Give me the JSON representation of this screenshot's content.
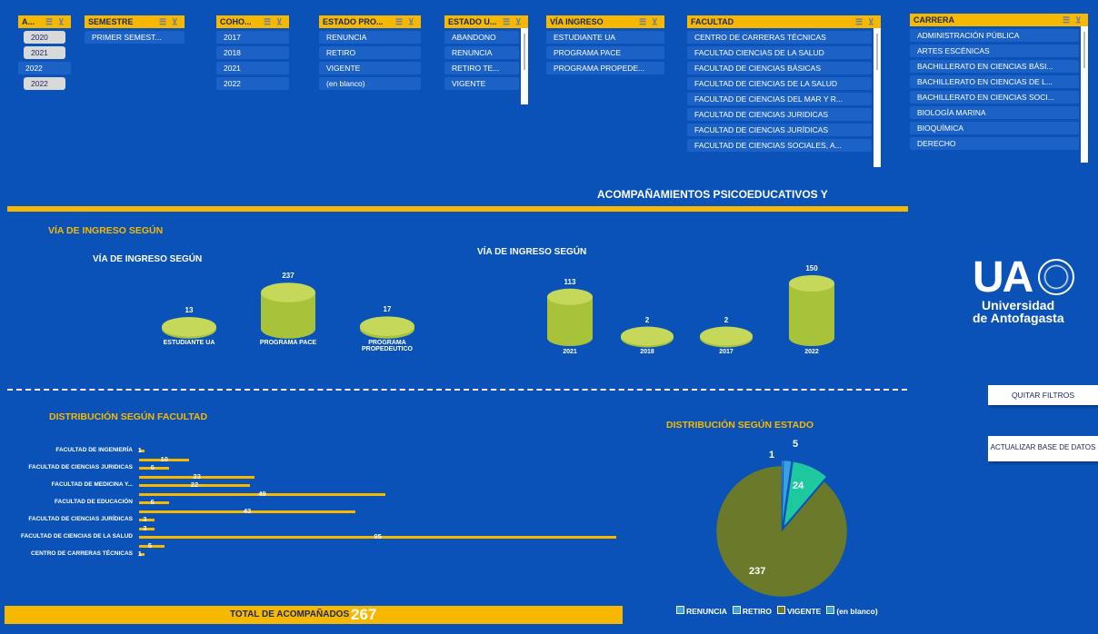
{
  "slicers": {
    "anio": {
      "title": "A...",
      "items": [
        "2020",
        "2021",
        "2022",
        "2022"
      ]
    },
    "semestre": {
      "title": "SEMESTRE",
      "items": [
        "PRIMER SEMEST..."
      ]
    },
    "cohorte": {
      "title": "COHO...",
      "items": [
        "2017",
        "2018",
        "2021",
        "2022"
      ]
    },
    "estado_pro": {
      "title": "ESTADO PRO...",
      "items": [
        "RENUNCIA",
        "RETIRO",
        "VIGENTE",
        "(en blanco)"
      ]
    },
    "estado_u": {
      "title": "ESTADO U...",
      "items": [
        "ABANDONO",
        "RENUNCIA",
        "RETIRO TE...",
        "VIGENTE"
      ]
    },
    "via_ingreso": {
      "title": "VÍA INGRESO",
      "items": [
        "ESTUDIANTE UA",
        "PROGRAMA PACE",
        "PROGRAMA PROPEDE..."
      ]
    },
    "facultad": {
      "title": "FACULTAD",
      "items": [
        "CENTRO DE CARRERAS TÉCNICAS",
        "FACULTAD CIENCIAS DE LA SALUD",
        "FACULTAD DE CIENCIAS BÁSICAS",
        "FACULTAD DE CIENCIAS DE LA SALUD",
        "FACULTAD DE CIENCIAS DEL MAR Y R...",
        "FACULTAD DE CIENCIAS JURIDICAS",
        "FACULTAD DE CIENCIAS JURÍDICAS",
        "FACULTAD DE CIENCIAS SOCIALES, A..."
      ]
    },
    "carrera": {
      "title": "CARRERA",
      "items": [
        "ADMINISTRACIÓN PÚBLICA",
        "ARTES ESCÉNICAS",
        "BACHILLERATO EN CIENCIAS BÁSI...",
        "BACHILLERATO EN CIENCIAS DE L...",
        "BACHILLERATO EN CIENCIAS SOCI...",
        "BIOLOGÍA MARINA",
        "BIOQUÍMICA",
        "DERECHO"
      ]
    }
  },
  "main_title": "ACOMPAÑAMIENTOS PSICOEDUCATIVOS Y",
  "section_via": "VÍA DE INGRESO SEGÚN",
  "section_facultad": "DISTRIBUCIÓN SEGÚN FACULTAD",
  "section_estado": "DISTRIBUCIÓN SEGÚN ESTADO",
  "total_label": "TOTAL DE ACOMPAÑADOS",
  "total_value": "267",
  "buttons": {
    "quitar": "QUITAR FILTROS",
    "actualizar": "ACTUALIZAR BASE DE DATOS"
  },
  "logo": {
    "ua": "UA",
    "line1": "Universidad",
    "line2": "de Antofagasta"
  },
  "colors": {
    "accent": "#f7b900",
    "background": "#0a52b8",
    "cylinder": "#a8c23a",
    "pie_main": "#6b7a2a",
    "pie_teal": "#1fc9a0",
    "pie_blue": "#3aa0e0"
  },
  "chart_data": [
    {
      "type": "bar",
      "title": "VÍA DE INGRESO SEGÚN",
      "categories": [
        "ESTUDIANTE UA",
        "PROGRAMA PACE",
        "PROGRAMA PROPEDEUTICO"
      ],
      "values": [
        13,
        237,
        17
      ]
    },
    {
      "type": "bar",
      "title": "VÍA DE INGRESO SEGÚN",
      "categories": [
        "2021",
        "2018",
        "2017",
        "2022"
      ],
      "values": [
        113,
        2,
        2,
        150
      ]
    },
    {
      "type": "bar",
      "title": "DISTRIBUCIÓN SEGÚN FACULTAD",
      "labels": [
        "FACULTAD DE INGENIERÍA",
        "",
        "FACULTAD DE CIENCIAS JURIDICAS",
        "",
        "FACULTAD DE MEDICINA Y...",
        "",
        "FACULTAD DE EDUCACIÓN",
        "",
        "FACULTAD DE CIENCIAS JURÍDICAS",
        "",
        "FACULTAD DE CIENCIAS DE LA SALUD",
        "",
        "CENTRO DE CARRERAS TÉCNICAS"
      ],
      "values": [
        1,
        10,
        6,
        23,
        22,
        49,
        6,
        43,
        3,
        3,
        95,
        5,
        1
      ]
    },
    {
      "type": "pie",
      "title": "DISTRIBUCIÓN SEGÚN ESTADO",
      "categories": [
        "RENUNCIA",
        "RETIRO",
        "VIGENTE",
        "(en blanco)"
      ],
      "values": [
        1,
        5,
        24,
        237
      ],
      "legend": [
        "RENUNCIA",
        "RETIRO",
        "VIGENTE",
        "(en blanco)"
      ]
    }
  ]
}
